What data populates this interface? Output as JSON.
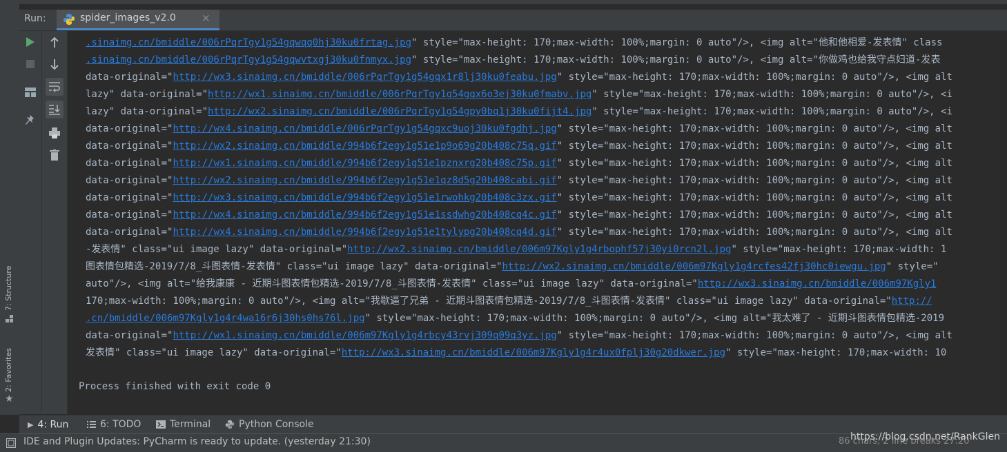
{
  "run_panel": {
    "label": "Run:",
    "tab_title": "spider_images_v2.0",
    "close_glyph": "×"
  },
  "side_tabs": {
    "structure": "7: Structure",
    "favorites": "2: Favorites"
  },
  "console": {
    "lines": [
      [
        {
          "t": ".sinaimg.cn/bmiddle/006rPqrTgy1g54gqwqq0hj30ku0frtag.jpg",
          "link": true
        },
        {
          "t": "\" style=\"max-height: 170;max-width: 100%;margin: 0 auto\"/>, <img alt=\"他和他相爱-发表情\" class"
        }
      ],
      [
        {
          "t": ".sinaimg.cn/bmiddle/006rPqrTgy1g54gqwvtxgj30ku0fnmyx.jpg",
          "link": true
        },
        {
          "t": "\" style=\"max-height: 170;max-width: 100%;margin: 0 auto\"/>, <img alt=\"你做鸡也给我守点妇道-发表"
        }
      ],
      [
        {
          "t": "data-original=\""
        },
        {
          "t": "http://wx3.sinaimg.cn/bmiddle/006rPqrTgy1g54gqx1r8lj30ku0feabu.jpg",
          "link": true
        },
        {
          "t": "\" style=\"max-height: 170;max-width: 100%;margin: 0 auto\"/>, <img alt"
        }
      ],
      [
        {
          "t": "lazy\" data-original=\""
        },
        {
          "t": "http://wx1.sinaimg.cn/bmiddle/006rPqrTgy1g54gqx6o3ej30ku0fmabv.jpg",
          "link": true
        },
        {
          "t": "\" style=\"max-height: 170;max-width: 100%;margin: 0 auto\"/>, <i"
        }
      ],
      [
        {
          "t": "lazy\" data-original=\""
        },
        {
          "t": "http://wx2.sinaimg.cn/bmiddle/006rPqrTgy1g54gpy0bq1j30ku0fijt4.jpg",
          "link": true
        },
        {
          "t": "\" style=\"max-height: 170;max-width: 100%;margin: 0 auto\"/>, <i"
        }
      ],
      [
        {
          "t": "data-original=\""
        },
        {
          "t": "http://wx4.sinaimg.cn/bmiddle/006rPqrTgy1g54gqxc9uoj30ku0fgdhj.jpg",
          "link": true
        },
        {
          "t": "\" style=\"max-height: 170;max-width: 100%;margin: 0 auto\"/>, <img alt"
        }
      ],
      [
        {
          "t": "data-original=\""
        },
        {
          "t": "http://wx2.sinaimg.cn/bmiddle/994b6f2egy1g51e1p9o69g20b408c75q.gif",
          "link": true
        },
        {
          "t": "\" style=\"max-height: 170;max-width: 100%;margin: 0 auto\"/>, <img alt"
        }
      ],
      [
        {
          "t": "data-original=\""
        },
        {
          "t": "http://wx1.sinaimg.cn/bmiddle/994b6f2egy1g51e1pznxrg20b408c75p.gif",
          "link": true
        },
        {
          "t": "\" style=\"max-height: 170;max-width: 100%;margin: 0 auto\"/>, <img alt"
        }
      ],
      [
        {
          "t": "data-original=\""
        },
        {
          "t": "http://wx2.sinaimg.cn/bmiddle/994b6f2egy1g51e1qz8d5g20b408cabi.gif",
          "link": true
        },
        {
          "t": "\" style=\"max-height: 170;max-width: 100%;margin: 0 auto\"/>, <img alt"
        }
      ],
      [
        {
          "t": "data-original=\""
        },
        {
          "t": "http://wx3.sinaimg.cn/bmiddle/994b6f2egy1g51e1rwohkg20b408c3zx.gif",
          "link": true
        },
        {
          "t": "\" style=\"max-height: 170;max-width: 100%;margin: 0 auto\"/>, <img alt"
        }
      ],
      [
        {
          "t": "data-original=\""
        },
        {
          "t": "http://wx4.sinaimg.cn/bmiddle/994b6f2egy1g51e1ssdwhg20b408cq4c.gif",
          "link": true
        },
        {
          "t": "\" style=\"max-height: 170;max-width: 100%;margin: 0 auto\"/>, <img alt"
        }
      ],
      [
        {
          "t": "data-original=\""
        },
        {
          "t": "http://wx4.sinaimg.cn/bmiddle/994b6f2egy1g51e1tylypg20b408cq4d.gif",
          "link": true
        },
        {
          "t": "\" style=\"max-height: 170;max-width: 100%;margin: 0 auto\"/>, <img alt"
        }
      ],
      [
        {
          "t": "-发表情\" class=\"ui image lazy\" data-original=\""
        },
        {
          "t": "http://wx2.sinaimg.cn/bmiddle/006m97Kgly1g4rbophf57j30yi0rcn2l.jpg",
          "link": true
        },
        {
          "t": "\" style=\"max-height: 170;max-width: 1"
        }
      ],
      [
        {
          "t": "图表情包精选-2019/7/8_斗图表情-发表情\" class=\"ui image lazy\" data-original=\""
        },
        {
          "t": "http://wx2.sinaimg.cn/bmiddle/006m97Kgly1g4rcfes42fj30hc0iewgu.jpg",
          "link": true
        },
        {
          "t": "\" style=\""
        }
      ],
      [
        {
          "t": "auto\"/>, <img alt=\"给我康康 - 近期斗图表情包精选-2019/7/8_斗图表情-发表情\" class=\"ui image lazy\" data-original=\""
        },
        {
          "t": "http://wx3.sinaimg.cn/bmiddle/006m97Kgly1",
          "link": true
        }
      ],
      [
        {
          "t": "170;max-width: 100%;margin: 0 auto\"/>, <img alt=\"我歇逼了兄弟 - 近期斗图表情包精选-2019/7/8_斗图表情-发表情\" class=\"ui image lazy\" data-original=\""
        },
        {
          "t": "http://",
          "link": true
        }
      ],
      [
        {
          "t": ".cn/bmiddle/006m97Kgly1g4r4wa16r6j30hs0hs76l.jpg",
          "link": true
        },
        {
          "t": "\" style=\"max-height: 170;max-width: 100%;margin: 0 auto\"/>, <img alt=\"我太难了 - 近期斗图表情包精选-2019"
        }
      ],
      [
        {
          "t": "data-original=\""
        },
        {
          "t": "http://wx1.sinaimg.cn/bmiddle/006m97Kgly1g4rbcy43rvj309q09q3yz.jpg",
          "link": true
        },
        {
          "t": "\" style=\"max-height: 170;max-width: 100%;margin: 0 auto\"/>, <img alt"
        }
      ],
      [
        {
          "t": "发表情\" class=\"ui image lazy\" data-original=\""
        },
        {
          "t": "http://wx3.sinaimg.cn/bmiddle/006m97Kgly1g4r4ux0fplj30g20dkwer.jpg",
          "link": true
        },
        {
          "t": "\" style=\"max-height: 170;max-width: 10"
        }
      ]
    ],
    "exit_message": "Process finished with exit code 0"
  },
  "bottom_tabs": {
    "run": "4: Run",
    "todo": "6: TODO",
    "terminal": "Terminal",
    "python_console": "Python Console"
  },
  "status_bar": {
    "message": "IDE and Plugin Updates: PyCharm is ready to update. (yesterday 21:30)",
    "right_info": "86 chars, 2 line breaks   27:20",
    "watermark": "https://blog.csdn.net/RankGlen"
  },
  "colors": {
    "background": "#2b2b2b",
    "panel": "#3c3f41",
    "console_text": "#a9b7c6",
    "link": "#287bde",
    "run_green": "#59a869"
  }
}
